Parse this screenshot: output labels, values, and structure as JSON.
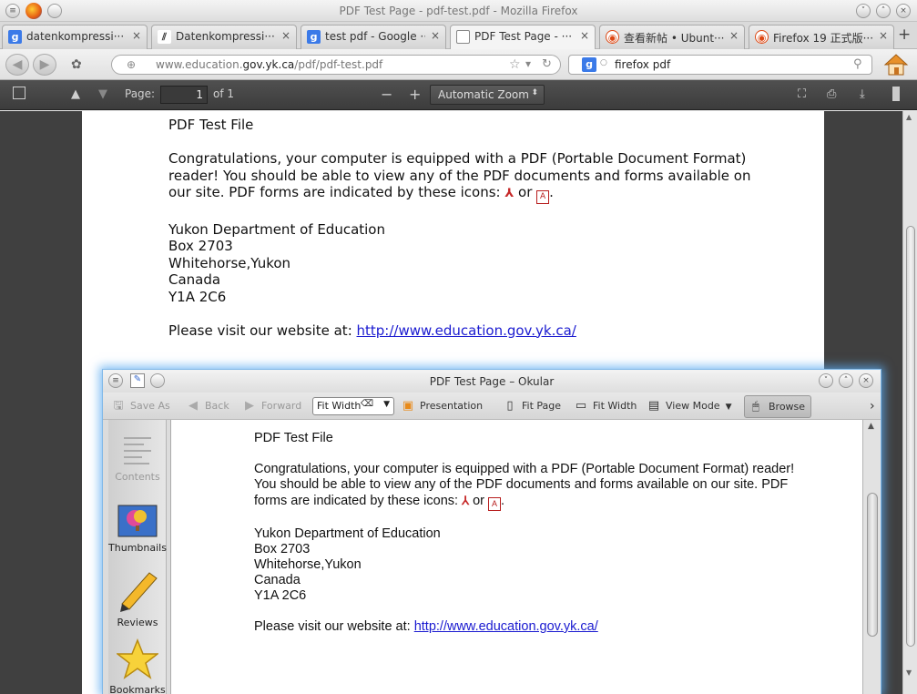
{
  "firefox": {
    "window_title": "PDF Test Page - pdf-test.pdf - Mozilla Firefox",
    "tabs": [
      {
        "label": "datenkompressi···",
        "icon": "google-icon"
      },
      {
        "label": "Datenkompressi···",
        "icon": "wikipedia-icon"
      },
      {
        "label": "test pdf - Google ···",
        "icon": "google-icon"
      },
      {
        "label": "PDF Test Page - ···",
        "icon": "document-icon",
        "active": true
      },
      {
        "label": "查看新帖 • Ubunt···",
        "icon": "ubuntu-icon"
      },
      {
        "label": "Firefox 19 正式版···",
        "icon": "ubuntu-icon"
      }
    ],
    "tab_close": "×",
    "url_prefix": "www.education.",
    "url_domain": "gov.yk.ca",
    "url_path": "/pdf/pdf-test.pdf",
    "search_value": "firefox pdf",
    "new_tab": "+"
  },
  "pdfjs": {
    "page_label": "Page:",
    "page_value": "1",
    "page_count": "of 1",
    "zoom_minus": "−",
    "zoom_plus": "+",
    "zoom_value": "Automatic Zoom"
  },
  "document": {
    "title": "PDF Test File",
    "para1": "Congratulations, your computer is equipped with a PDF (Portable Document Format) reader!  You should be able to view any of the PDF documents and forms available on our site.  PDF forms are indicated by these icons: ",
    "or": " or ",
    "period": ".",
    "address": [
      "Yukon Department of Education",
      "Box 2703",
      "Whitehorse,Yukon",
      "Canada",
      "Y1A 2C6"
    ],
    "visit_text": "Please visit our website at:  ",
    "website": "http://www.education.gov.yk.ca/"
  },
  "okular": {
    "window_title": "PDF Test Page – Okular",
    "toolbar": {
      "save_as": "Save As",
      "back": "Back",
      "forward": "Forward",
      "fit_width_select": "Fit Width",
      "presentation": "Presentation",
      "fit_page": "Fit Page",
      "fit_width": "Fit Width",
      "view_mode": "View Mode",
      "browse": "Browse",
      "more": "›"
    },
    "sidebar": [
      "Contents",
      "Thumbnails",
      "Reviews",
      "Bookmarks"
    ]
  },
  "colors": {
    "link": "#1a1ad0",
    "okular_glow": "#5aaaf0",
    "pdf_toolbar": "#474747"
  }
}
